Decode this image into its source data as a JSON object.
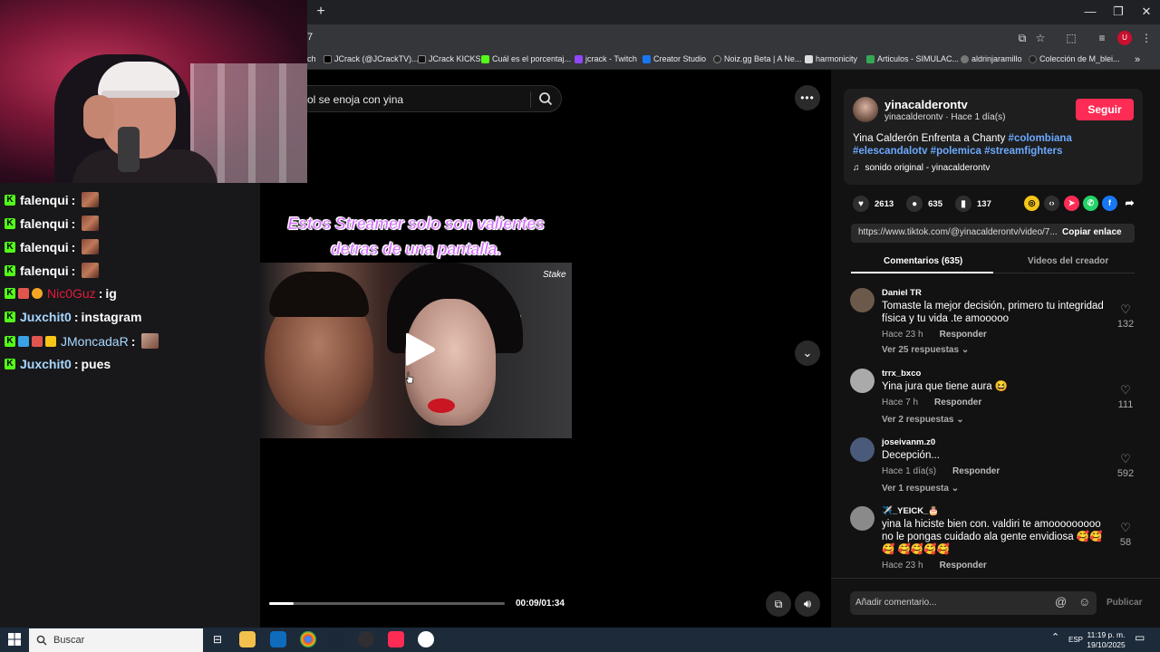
{
  "browser": {
    "new_tab": "+",
    "url_tail": "7",
    "bookmarks": [
      {
        "label": "ch",
        "color": "#4a4a4a"
      },
      {
        "label": "JCrack (@JCrackTV)...",
        "color": "#000000"
      },
      {
        "label": "JCrack KICKS",
        "color": "#111111"
      },
      {
        "label": "Cuál es el porcentaj...",
        "color": "#53fc18"
      },
      {
        "label": "jcrack - Twitch",
        "color": "#9146ff"
      },
      {
        "label": "Creator Studio",
        "color": "#1877f2"
      },
      {
        "label": "Noiz.gg Beta | A Ne...",
        "color": "#2a2a2a"
      },
      {
        "label": "harmonicity",
        "color": "#dddddd"
      },
      {
        "label": "Articulos - SIMULAC...",
        "color": "#34a853"
      },
      {
        "label": "aldrinjaramillo",
        "color": "#777777"
      },
      {
        "label": "Colección de M_blei...",
        "color": "#222222"
      }
    ],
    "more_bookmarks": "»"
  },
  "chat": {
    "messages": [
      {
        "user": "falenqui",
        "text": "",
        "color": "#ffffff",
        "emote": true
      },
      {
        "user": "falenqui",
        "text": "",
        "color": "#ffffff",
        "emote": true
      },
      {
        "user": "falenqui",
        "text": "",
        "color": "#ffffff",
        "emote": true
      },
      {
        "user": "falenqui",
        "text": "",
        "color": "#ffffff",
        "emote": true
      },
      {
        "user": "Nic0Guz",
        "text": "ig",
        "color": "#e01b3c",
        "emote": false
      },
      {
        "user": "Juxchit0",
        "text": "instagram",
        "color": "#a8d8ff",
        "emote": false
      },
      {
        "user": "JMoncadaR",
        "text": "",
        "color": "#a8d8ff",
        "emote": true
      },
      {
        "user": "Juxchit0",
        "text": "pues",
        "color": "#a8d8ff",
        "emote": false
      }
    ]
  },
  "search": {
    "value": "ol se enoja con yina"
  },
  "video": {
    "caption_line1": "Estos Streamer solo son valientes",
    "caption_line2": "detras de una pantalla.",
    "watermark": "Stake",
    "time": "00:09/01:34",
    "progress": 0.105
  },
  "post": {
    "username": "yinacalderontv",
    "subline": "yinacalderontv · Hace 1 día(s)",
    "follow": "Seguir",
    "desc_text": "Yina Calderón Enfrenta a Chanty ",
    "tags": [
      "#colombiana",
      "#elescandalotv",
      "#polemica",
      "#streamfighters"
    ],
    "sound": "sonido original - yinacalderontv",
    "likes": "2613",
    "comments": "635",
    "saves": "137",
    "link": "https://www.tiktok.com/@yinacalderontv/video/7...",
    "copy_link": "Copiar enlace",
    "tab_comments": "Comentarios (635)",
    "tab_videos": "Videos del creador"
  },
  "comments": [
    {
      "user": "Daniel TR",
      "text": "Tomaste la mejor decisión, primero tu integridad física y tu vida .te amooooo",
      "time": "Hace 23 h",
      "reply": "Responder",
      "more": "Ver 25 respuestas ⌄",
      "likes": "132",
      "avatar": "#6b5a4a"
    },
    {
      "user": "trrx_bxco",
      "text": "Yina jura que tiene aura 😆",
      "time": "Hace 7 h",
      "reply": "Responder",
      "more": "Ver 2 respuestas ⌄",
      "likes": "111",
      "avatar": "#aaaaaa"
    },
    {
      "user": "joseivanm.z0",
      "text": "Decepción...",
      "time": "Hace 1 día(s)",
      "reply": "Responder",
      "more": "Ver 1 respuesta ⌄",
      "likes": "592",
      "avatar": "#4a5a7a"
    },
    {
      "user": "✈️_YEICK_🎂",
      "text": "yina la hiciste bien con. valdiri te amooooooooo no le pongas cuidado ala gente envidiosa 🥰🥰🥰 🥰🥰🥰🥰",
      "time": "Hace 23 h",
      "reply": "Responder",
      "more": "",
      "likes": "58",
      "avatar": "#8a8a8a"
    }
  ],
  "comment_bar": {
    "placeholder": "Añadir comentario...",
    "publish": "Publicar"
  },
  "taskbar": {
    "search": "Buscar",
    "lang": "ESP",
    "time": "11:19 p. m.",
    "date": "19/10/2025"
  },
  "colors": {
    "accent": "#fe2c55",
    "kick": "#53fc18",
    "tag": "#6aa9ff"
  }
}
